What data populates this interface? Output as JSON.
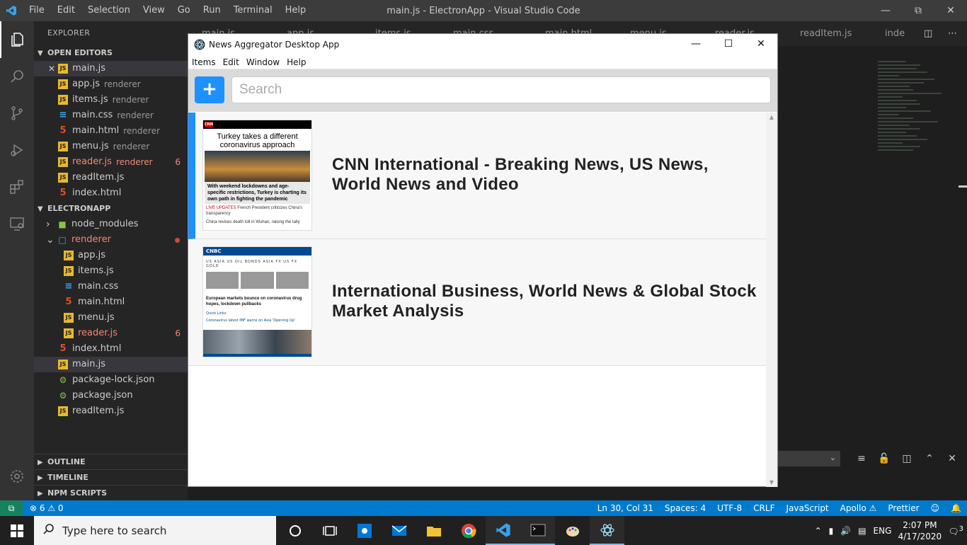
{
  "vscode": {
    "menu": [
      "File",
      "Edit",
      "Selection",
      "View",
      "Go",
      "Run",
      "Terminal",
      "Help"
    ],
    "title": "main.js - ElectronApp - Visual Studio Code",
    "tabs": [
      {
        "label": "main.js"
      },
      {
        "label": "app.js"
      },
      {
        "label": "items.js"
      },
      {
        "label": "main.css"
      },
      {
        "label": "main.html"
      },
      {
        "label": "menu.js"
      },
      {
        "label": "reader.js"
      },
      {
        "label": "readItem.js"
      },
      {
        "label": "inde"
      }
    ]
  },
  "explorer": {
    "title": "EXPLORER",
    "open_editors_label": "OPEN EDITORS",
    "open_editors": [
      {
        "name": "main.js",
        "desc": "",
        "type": "js"
      },
      {
        "name": "app.js",
        "desc": "renderer",
        "type": "js"
      },
      {
        "name": "items.js",
        "desc": "renderer",
        "type": "js"
      },
      {
        "name": "main.css",
        "desc": "renderer",
        "type": "css"
      },
      {
        "name": "main.html",
        "desc": "renderer",
        "type": "html"
      },
      {
        "name": "menu.js",
        "desc": "renderer",
        "type": "js"
      },
      {
        "name": "reader.js",
        "desc": "renderer",
        "type": "js",
        "errors": "6"
      },
      {
        "name": "readItem.js",
        "desc": "",
        "type": "js"
      },
      {
        "name": "index.html",
        "desc": "",
        "type": "html"
      }
    ],
    "project_label": "ELECTRONAPP",
    "tree": [
      {
        "name": "node_modules",
        "type": "folder",
        "depth": 0
      },
      {
        "name": "renderer",
        "type": "folder-open",
        "depth": 0
      },
      {
        "name": "app.js",
        "type": "js",
        "depth": 1
      },
      {
        "name": "items.js",
        "type": "js",
        "depth": 1
      },
      {
        "name": "main.css",
        "type": "css",
        "depth": 1
      },
      {
        "name": "main.html",
        "type": "html",
        "depth": 1
      },
      {
        "name": "menu.js",
        "type": "js",
        "depth": 1
      },
      {
        "name": "reader.js",
        "type": "js",
        "depth": 1,
        "errors": "6"
      },
      {
        "name": "index.html",
        "type": "html",
        "depth": 0
      },
      {
        "name": "main.js",
        "type": "js",
        "depth": 0
      },
      {
        "name": "package-lock.json",
        "type": "json",
        "depth": 0
      },
      {
        "name": "package.json",
        "type": "json",
        "depth": 0
      },
      {
        "name": "readItem.js",
        "type": "js",
        "depth": 0
      }
    ],
    "outline_label": "OUTLINE",
    "timeline_label": "TIMELINE",
    "npm_label": "NPM SCRIPTS"
  },
  "statusbar": {
    "problems": "⊗ 6 ⚠ 0",
    "position": "Ln 30, Col 31",
    "spaces": "Spaces: 4",
    "encoding": "UTF-8",
    "eol": "CRLF",
    "language": "JavaScript",
    "apollo": "Apollo ⚠",
    "prettier": "Prettier"
  },
  "taskbar": {
    "search_placeholder": "Type here to search",
    "lang": "ENG",
    "time": "2:07 PM",
    "date": "4/17/2020",
    "notifications": "3"
  },
  "app": {
    "title": "News Aggregator Desktop App",
    "menu": [
      "Items",
      "Edit",
      "Window",
      "Help"
    ],
    "add_label": "+",
    "search_placeholder": "Search",
    "items": [
      {
        "title": "CNN International - Breaking News, US News, World News and Video",
        "selected": true,
        "thumb": {
          "headline": "Turkey takes a different coronavirus approach",
          "sub": "With weekend lockdowns and age-specific restrictions, Turkey is charting its own path in fighting the pandemic",
          "live_tag": "LIVE UPDATES",
          "live": "French President criticizes China's transparency",
          "more": "China revises death toll in Wuhan, raising the tally"
        }
      },
      {
        "title": "International Business, World News & Global Stock Market Analysis",
        "selected": false,
        "thumb": {
          "brand": "CNBC",
          "tabs": "US  ASIA  US  OIL  BONDS  ASIA FX  US FX  GOLD",
          "headline": "European markets bounce on coronavirus drug hopes, lockdown pullbacks",
          "quick": "Quick Links",
          "links": "Coronavirus latest   IMF warns on Asia   'Opening Up'"
        }
      }
    ]
  }
}
